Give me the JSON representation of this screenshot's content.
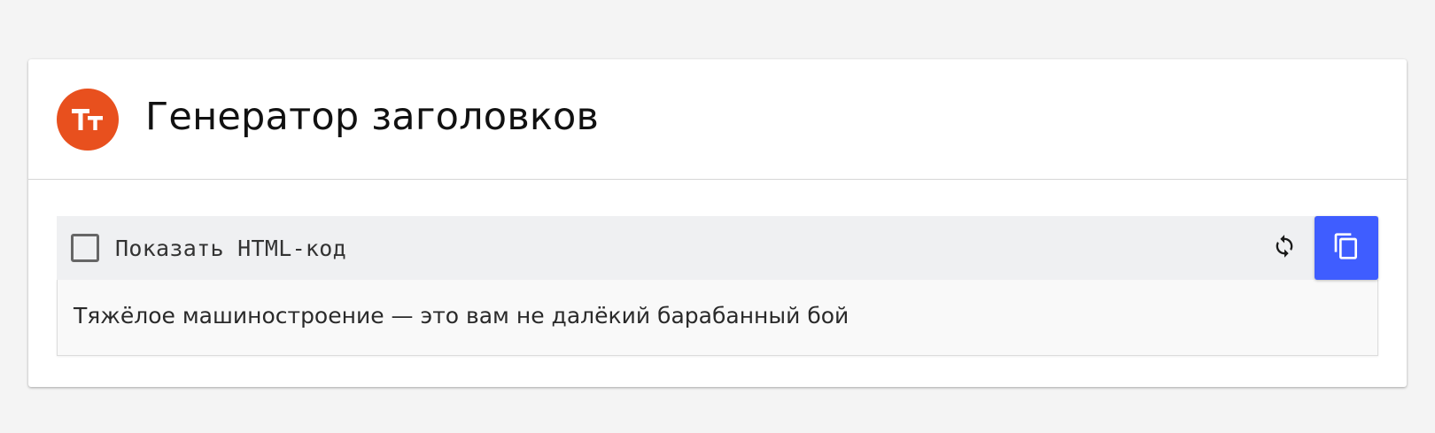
{
  "header": {
    "logo_letters": "Тт",
    "logo_color": "#e8501e",
    "title": "Генератор заголовков"
  },
  "toolbar": {
    "show_html_label": "Показать HTML-код",
    "show_html_checked": false,
    "refresh_icon": "refresh-icon",
    "copy_icon": "copy-icon",
    "accent_color": "#3f5dff"
  },
  "output": {
    "text": "Тяжёлое машиностроение — это вам не далёкий барабанный бой"
  }
}
